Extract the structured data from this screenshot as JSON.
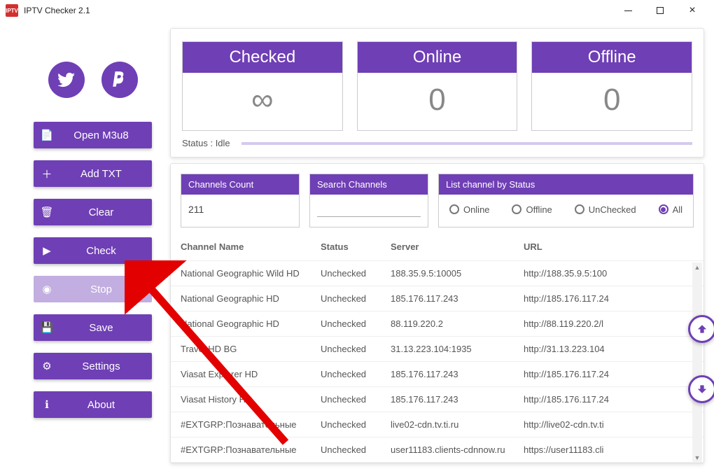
{
  "window": {
    "title": "IPTV Checker 2.1",
    "icon_text": "IPTV"
  },
  "sidebar": {
    "twitter_icon": "twitter-icon",
    "paypal_icon": "paypal-icon",
    "buttons": {
      "open": "Open M3u8",
      "add": "Add TXT",
      "clear": "Clear",
      "check": "Check",
      "stop": "Stop",
      "save": "Save",
      "settings": "Settings",
      "about": "About"
    }
  },
  "stats": {
    "checked_label": "Checked",
    "checked_value": "∞",
    "online_label": "Online",
    "online_value": "0",
    "offline_label": "Offline",
    "offline_value": "0",
    "status_text": "Status : Idle"
  },
  "filters": {
    "count_label": "Channels Count",
    "count_value": "211",
    "search_label": "Search Channels",
    "search_value": "",
    "radio_label": "List channel by Status",
    "options": {
      "online": "Online",
      "offline": "Offline",
      "unchecked": "UnChecked",
      "all": "All"
    },
    "selected": "all"
  },
  "table": {
    "columns": {
      "name": "Channel Name",
      "status": "Status",
      "server": "Server",
      "url": "URL"
    },
    "rows": [
      {
        "name": "National Geographic Wild HD",
        "status": "Unchecked",
        "server": "188.35.9.5:10005",
        "url": "http://188.35.9.5:100"
      },
      {
        "name": "National Geographic HD",
        "status": "Unchecked",
        "server": "185.176.117.243",
        "url": "http://185.176.117.24"
      },
      {
        "name": "National Geographic HD",
        "status": "Unchecked",
        "server": "88.119.220.2",
        "url": "http://88.119.220.2/l"
      },
      {
        "name": "Travel HD BG",
        "status": "Unchecked",
        "server": "31.13.223.104:1935",
        "url": "http://31.13.223.104"
      },
      {
        "name": "Viasat Explorer HD",
        "status": "Unchecked",
        "server": "185.176.117.243",
        "url": "http://185.176.117.24"
      },
      {
        "name": "Viasat History HD",
        "status": "Unchecked",
        "server": "185.176.117.243",
        "url": "http://185.176.117.24"
      },
      {
        "name": "#EXTGRP:Познавательные",
        "status": "Unchecked",
        "server": "live02-cdn.tv.ti.ru",
        "url": "http://live02-cdn.tv.ti"
      },
      {
        "name": "#EXTGRP:Познавательные",
        "status": "Unchecked",
        "server": "user11183.clients-cdnnow.ru",
        "url": "https://user11183.cli"
      }
    ]
  }
}
